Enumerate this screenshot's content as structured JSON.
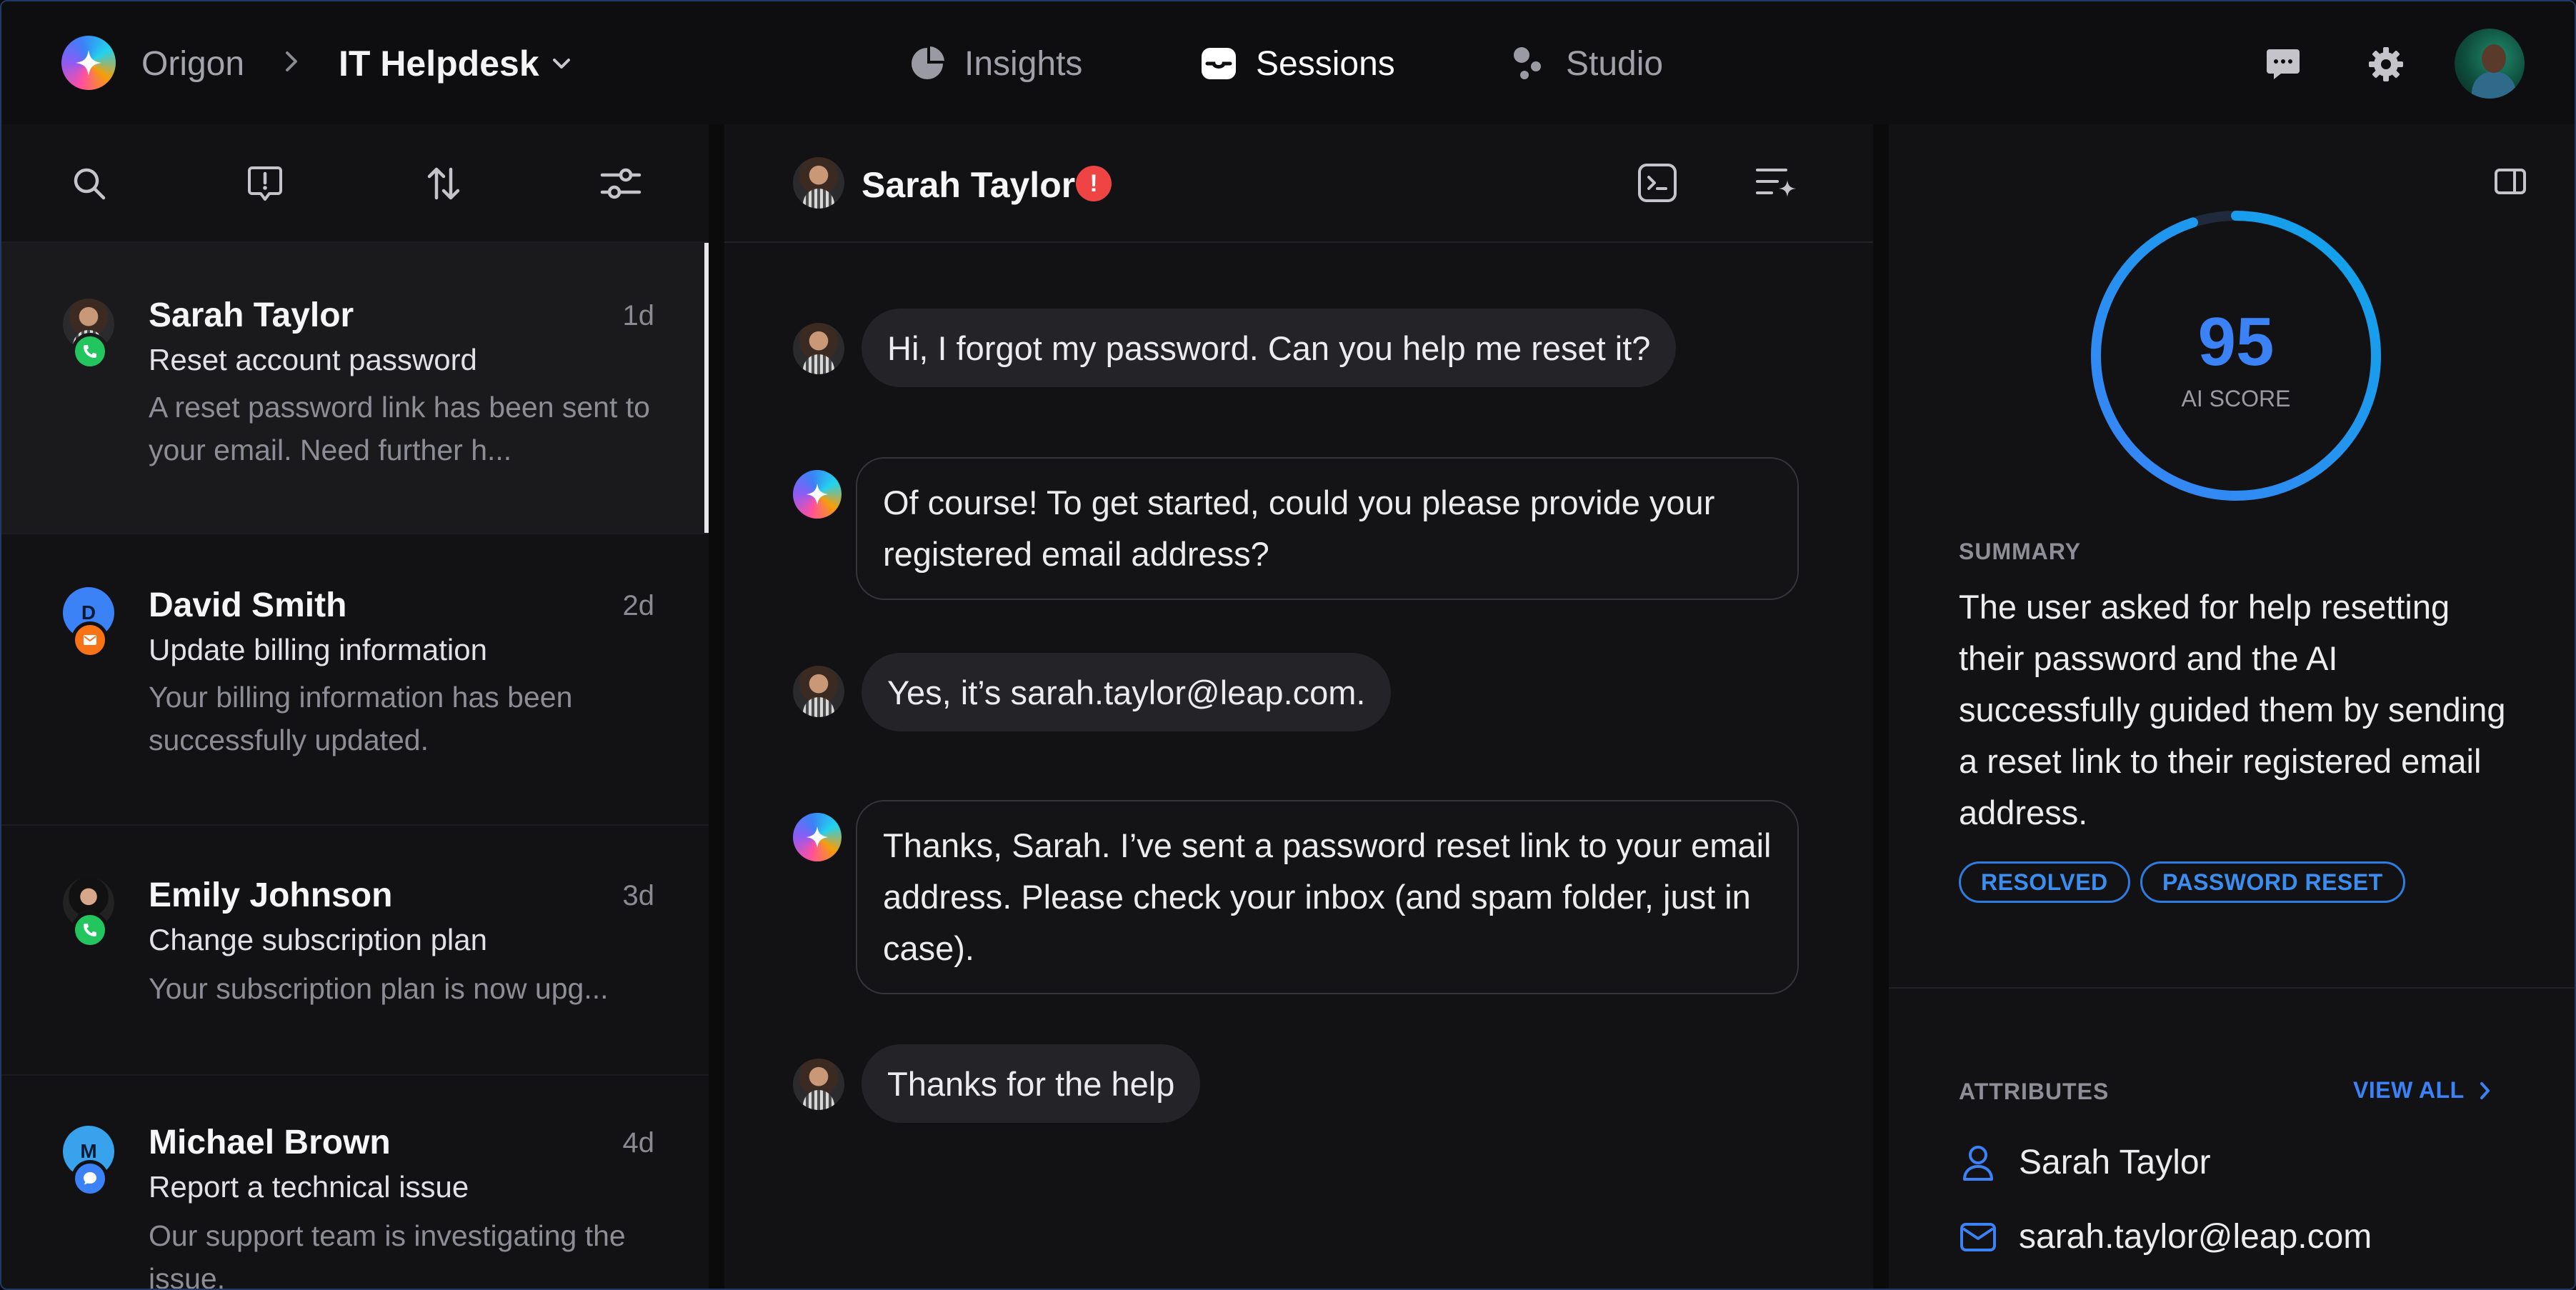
{
  "app": {
    "org": "Origon",
    "project": "IT Helpdesk"
  },
  "nav": [
    {
      "label": "Insights",
      "icon": "pie-chart-icon",
      "active": false
    },
    {
      "label": "Sessions",
      "icon": "inbox-icon",
      "active": true
    },
    {
      "label": "Studio",
      "icon": "studio-icon",
      "active": false
    }
  ],
  "sessions": [
    {
      "name": "Sarah Taylor",
      "time": "1d",
      "subject": "Reset account password",
      "preview": "A reset password link has been sent to your email. Need further h...",
      "channel": "phone",
      "avatar": "photo"
    },
    {
      "name": "David Smith",
      "time": "2d",
      "subject": "Update billing information",
      "preview": "Your billing information has been successfully updated.",
      "channel": "email",
      "avatar": "D"
    },
    {
      "name": "Emily Johnson",
      "time": "3d",
      "subject": "Change subscription plan",
      "preview": "Your subscription plan is now upg...",
      "channel": "phone",
      "avatar": "photo"
    },
    {
      "name": "Michael Brown",
      "time": "4d",
      "subject": "Report a technical issue",
      "preview": "Our support team is investigating the issue.",
      "channel": "chat",
      "avatar": "M"
    }
  ],
  "conversation": {
    "contact": "Sarah Taylor",
    "alert": "!",
    "messages": [
      {
        "from": "user",
        "text": "Hi, I forgot my password. Can you help me reset it?"
      },
      {
        "from": "bot",
        "text": "Of course! To get started, could you please provide your registered email address?"
      },
      {
        "from": "user",
        "text": "Yes, it’s sarah.taylor@leap.com."
      },
      {
        "from": "bot",
        "text": "Thanks, Sarah. I’ve sent a password reset link to your email address. Please check your inbox (and spam folder, just in case)."
      },
      {
        "from": "user",
        "text": "Thanks for the help"
      }
    ]
  },
  "details": {
    "score": "95",
    "score_fraction": 0.95,
    "score_label": "AI SCORE",
    "summary_label": "SUMMARY",
    "summary": "The user asked for help resetting their password and the AI successfully guided them by sending a reset link to their registered email address.",
    "tags": [
      "RESOLVED",
      "PASSWORD RESET"
    ],
    "attributes_label": "ATTRIBUTES",
    "view_all": "VIEW ALL",
    "attributes": [
      {
        "icon": "user-icon",
        "value": "Sarah Taylor"
      },
      {
        "icon": "mail-icon",
        "value": "sarah.taylor@leap.com"
      }
    ]
  },
  "colors": {
    "accent": "#3b82f6",
    "alert": "#ef4444",
    "phone": "#22c55e",
    "email": "#f97316",
    "chat": "#3b82f6"
  }
}
